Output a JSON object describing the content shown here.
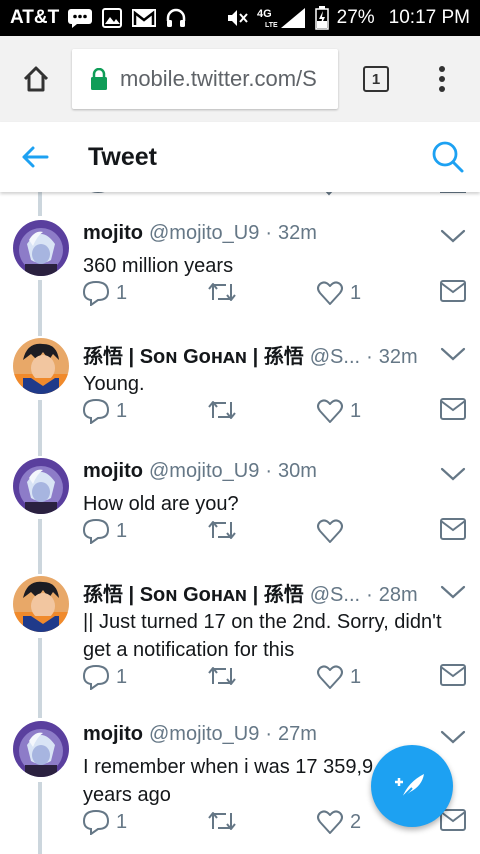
{
  "status_bar": {
    "carrier": "AT&T",
    "network": "4G LTE",
    "battery": "27%",
    "time": "10:17 PM"
  },
  "browser": {
    "url": "mobile.twitter.com/S",
    "tab_count": "1"
  },
  "header": {
    "title": "Tweet"
  },
  "tweets": [
    {
      "name": "mojito",
      "handle": "@mojito_U9",
      "sep": "·",
      "time": "32m",
      "text": "360 million years",
      "replies": "1",
      "likes": "1",
      "avatar": "mojito"
    },
    {
      "name": "孫悟 | Sᴏɴ Gᴏʜᴀɴ | 孫悟",
      "handle": "@S...",
      "sep": "·",
      "time": "32m",
      "text": "Young.",
      "replies": "1",
      "likes": "1",
      "avatar": "gohan"
    },
    {
      "name": "mojito",
      "handle": "@mojito_U9",
      "sep": "·",
      "time": "30m",
      "text": "How old are you?",
      "replies": "1",
      "likes": "",
      "avatar": "mojito"
    },
    {
      "name": "孫悟 | Sᴏɴ Gᴏʜᴀɴ | 孫悟",
      "handle": "@S...",
      "sep": "·",
      "time": "28m",
      "text": "|| Just turned 17 on the 2nd. Sorry, didn't get a notification for this",
      "replies": "1",
      "likes": "1",
      "avatar": "gohan"
    },
    {
      "name": "mojito",
      "handle": "@mojito_U9",
      "sep": "·",
      "time": "27m",
      "text": "I remember when i was 17 359,9",
      "text_line2": "years ago",
      "replies": "1",
      "likes": "2",
      "avatar": "mojito"
    }
  ],
  "colors": {
    "twitter_blue": "#1da1f2",
    "secure_lock": "#0f9d58",
    "muted_text": "#657786",
    "thread_line": "#ccd6dd"
  }
}
